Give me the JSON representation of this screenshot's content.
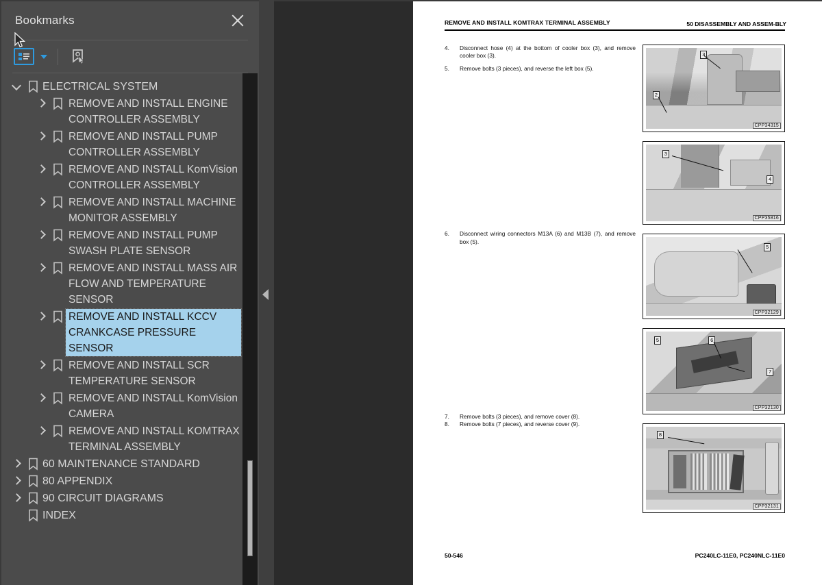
{
  "panel": {
    "title": "Bookmarks",
    "close_icon": "close-icon",
    "toolbar": {
      "expand_bookmarks_icon": "bookmark-list-icon",
      "dropdown_icon": "chevron-down-icon",
      "new_bookmark_icon": "bookmark-pointer-icon"
    }
  },
  "tree": [
    {
      "label": "ELECTRICAL SYSTEM",
      "level": 0,
      "state": "expanded",
      "selected": false
    },
    {
      "label": "REMOVE AND INSTALL ENGINE CONTROLLER ASSEMBLY",
      "level": 1,
      "state": "collapsed",
      "selected": false
    },
    {
      "label": "REMOVE AND INSTALL PUMP CONTROLLER ASSEMBLY",
      "level": 1,
      "state": "collapsed",
      "selected": false
    },
    {
      "label": "REMOVE AND INSTALL KomVision CONTROLLER ASSEMBLY",
      "level": 1,
      "state": "collapsed",
      "selected": false
    },
    {
      "label": "REMOVE AND INSTALL MACHINE MONITOR ASSEMBLY",
      "level": 1,
      "state": "collapsed",
      "selected": false
    },
    {
      "label": "REMOVE AND INSTALL PUMP SWASH PLATE SENSOR",
      "level": 1,
      "state": "collapsed",
      "selected": false
    },
    {
      "label": "REMOVE AND INSTALL MASS AIR FLOW AND TEMPERATURE SENSOR",
      "level": 1,
      "state": "collapsed",
      "selected": false
    },
    {
      "label": "REMOVE AND INSTALL KCCV CRANKCASE PRESSURE SENSOR",
      "level": 1,
      "state": "collapsed",
      "selected": true
    },
    {
      "label": "REMOVE AND INSTALL SCR TEMPERATURE SENSOR",
      "level": 1,
      "state": "collapsed",
      "selected": false
    },
    {
      "label": "REMOVE AND INSTALL KomVision CAMERA",
      "level": 1,
      "state": "collapsed",
      "selected": false
    },
    {
      "label": "REMOVE AND INSTALL KOMTRAX TERMINAL ASSEMBLY",
      "level": 1,
      "state": "collapsed",
      "selected": false
    },
    {
      "label": "60 MAINTENANCE STANDARD",
      "level": 0,
      "state": "collapsed",
      "selected": false
    },
    {
      "label": "80 APPENDIX",
      "level": 0,
      "state": "collapsed",
      "selected": false
    },
    {
      "label": "90 CIRCUIT DIAGRAMS",
      "level": 0,
      "state": "collapsed",
      "selected": false
    },
    {
      "label": "INDEX",
      "level": 0,
      "state": "leaf",
      "selected": false
    }
  ],
  "splitter": {
    "collapse_icon": "triangle-left-icon"
  },
  "document": {
    "header_left": "REMOVE AND INSTALL KOMTRAX TERMINAL ASSEMBLY",
    "header_right": "50 DISASSEMBLY AND ASSEM-BLY",
    "steps": [
      {
        "num": "4.",
        "text": "Disconnect hose (4) at the bottom of cooler box (3), and remove cooler box (3)."
      },
      {
        "num": "5.",
        "text": "Remove bolts (3 pieces), and reverse the left box (5)."
      },
      {
        "num": "6.",
        "text": "Disconnect wiring connectors M13A (6) and M13B (7), and remove box (5)."
      },
      {
        "num": "7.",
        "text": "Remove bolts (3 pieces), and remove cover (8)."
      },
      {
        "num": "8.",
        "text": "Remove bolts (7 pieces), and reverse cover (9)."
      }
    ],
    "figures": [
      {
        "code": "CPP34315",
        "callouts": [
          "3",
          "2"
        ]
      },
      {
        "code": "CPP35816",
        "callouts": [
          "3",
          "4"
        ]
      },
      {
        "code": "CPP32129",
        "callouts": [
          "5"
        ]
      },
      {
        "code": "CPP32130",
        "callouts": [
          "5",
          "6",
          "7"
        ]
      },
      {
        "code": "CPP32131",
        "callouts": [
          "8"
        ]
      }
    ],
    "footer_left": "50-546",
    "footer_right": "PC240LC-11E0, PC240NLC-11E0"
  },
  "colors": {
    "panel_bg": "#4b4b4b",
    "viewer_bg": "#2b2b2b",
    "selection": "#a5d2ec",
    "accent": "#2e9be0"
  }
}
